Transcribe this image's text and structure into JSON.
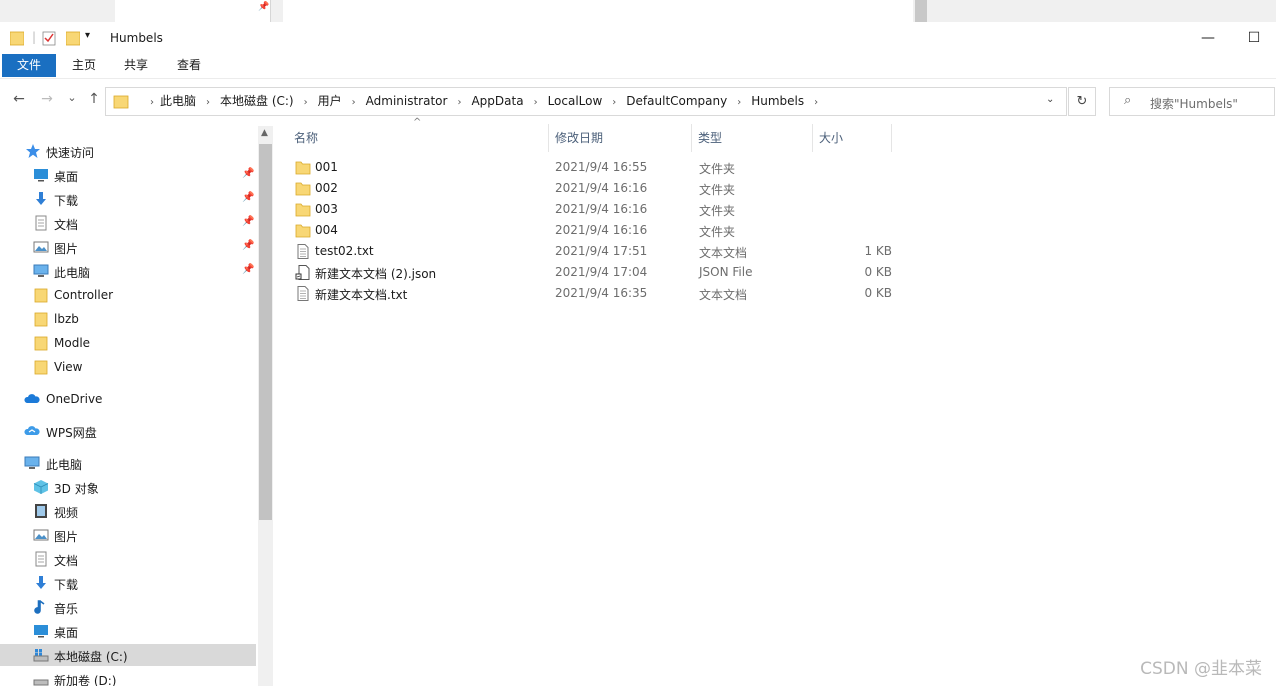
{
  "window": {
    "title": "Humbels",
    "minimize_glyph": "—",
    "maximize_glyph": "☐"
  },
  "ribbon": {
    "tabs": [
      "文件",
      "主页",
      "共享",
      "查看"
    ]
  },
  "nav": {
    "back": "←",
    "forward": "→",
    "recent": "⌄",
    "up": "↑",
    "refresh": "↻",
    "breadcrumbs": [
      "此电脑",
      "本地磁盘 (C:)",
      "用户",
      "Administrator",
      "AppData",
      "LocalLow",
      "DefaultCompany",
      "Humbels"
    ],
    "search_placeholder": "搜索\"Humbels\""
  },
  "sidebar": {
    "items": [
      {
        "label": "快速访问",
        "icon": "star-icon",
        "level": 0,
        "pinned": false
      },
      {
        "label": "桌面",
        "icon": "desktop-icon",
        "level": 1,
        "pinned": true
      },
      {
        "label": "下载",
        "icon": "download-icon",
        "level": 1,
        "pinned": true
      },
      {
        "label": "文档",
        "icon": "document-icon",
        "level": 1,
        "pinned": true
      },
      {
        "label": "图片",
        "icon": "picture-icon",
        "level": 1,
        "pinned": true
      },
      {
        "label": "此电脑",
        "icon": "computer-icon",
        "level": 1,
        "pinned": true
      },
      {
        "label": "Controller",
        "icon": "folder-icon",
        "level": 1,
        "pinned": false
      },
      {
        "label": "lbzb",
        "icon": "folder-icon",
        "level": 1,
        "pinned": false
      },
      {
        "label": "Modle",
        "icon": "folder-icon",
        "level": 1,
        "pinned": false
      },
      {
        "label": "View",
        "icon": "folder-icon",
        "level": 1,
        "pinned": false
      },
      {
        "label": "OneDrive",
        "icon": "cloud-icon",
        "level": 0,
        "pinned": false
      },
      {
        "label": "WPS网盘",
        "icon": "wps-cloud-icon",
        "level": 0,
        "pinned": false
      },
      {
        "label": "此电脑",
        "icon": "computer-icon",
        "level": 0,
        "pinned": false
      },
      {
        "label": "3D 对象",
        "icon": "cube-icon",
        "level": 1,
        "pinned": false
      },
      {
        "label": "视频",
        "icon": "video-icon",
        "level": 1,
        "pinned": false
      },
      {
        "label": "图片",
        "icon": "picture-icon",
        "level": 1,
        "pinned": false
      },
      {
        "label": "文档",
        "icon": "document-icon",
        "level": 1,
        "pinned": false
      },
      {
        "label": "下载",
        "icon": "download-icon",
        "level": 1,
        "pinned": false
      },
      {
        "label": "音乐",
        "icon": "music-icon",
        "level": 1,
        "pinned": false
      },
      {
        "label": "桌面",
        "icon": "desktop-icon",
        "level": 1,
        "pinned": false
      },
      {
        "label": "本地磁盘 (C:)",
        "icon": "drive-icon",
        "level": 1,
        "pinned": false,
        "selected": true
      },
      {
        "label": "新加卷 (D:)",
        "icon": "drive-icon",
        "level": 1,
        "pinned": false
      }
    ]
  },
  "filelist": {
    "headers": {
      "name": "名称",
      "date": "修改日期",
      "type": "类型",
      "size": "大小"
    },
    "sort_caret": "^",
    "rows": [
      {
        "name": "001",
        "date": "2021/9/4 16:55",
        "type": "文件夹",
        "size": "",
        "icon": "folder-icon"
      },
      {
        "name": "002",
        "date": "2021/9/4 16:16",
        "type": "文件夹",
        "size": "",
        "icon": "folder-icon"
      },
      {
        "name": "003",
        "date": "2021/9/4 16:16",
        "type": "文件夹",
        "size": "",
        "icon": "folder-icon"
      },
      {
        "name": "004",
        "date": "2021/9/4 16:16",
        "type": "文件夹",
        "size": "",
        "icon": "folder-icon"
      },
      {
        "name": "test02.txt",
        "date": "2021/9/4 17:51",
        "type": "文本文档",
        "size": "1 KB",
        "icon": "text-file-icon"
      },
      {
        "name": "新建文本文档 (2).json",
        "date": "2021/9/4 17:04",
        "type": "JSON File",
        "size": "0 KB",
        "icon": "json-file-icon"
      },
      {
        "name": "新建文本文档.txt",
        "date": "2021/9/4 16:35",
        "type": "文本文档",
        "size": "0 KB",
        "icon": "text-file-icon"
      }
    ]
  },
  "watermark": "CSDN @韭本菜",
  "colors": {
    "accent": "#1a6fc1",
    "folder": "#f8d775",
    "selection": "#d9d9d9"
  }
}
